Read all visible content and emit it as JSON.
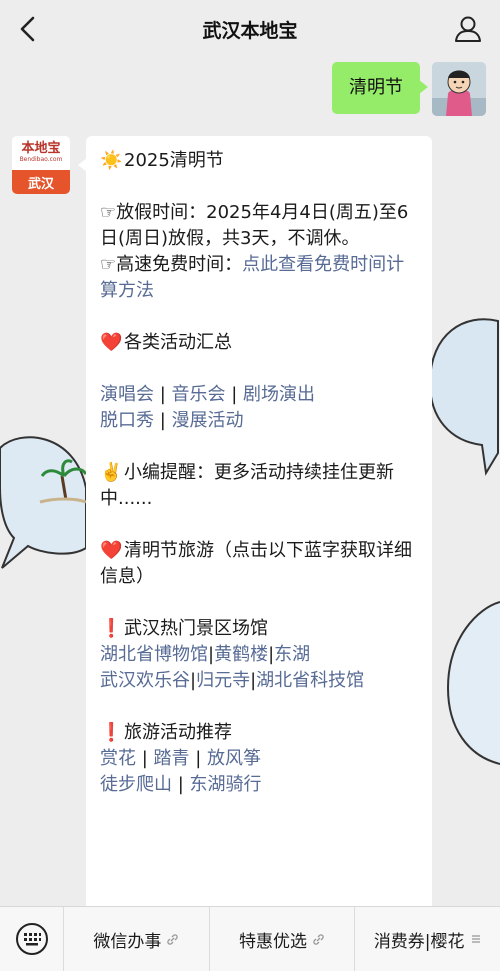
{
  "header": {
    "title": "武汉本地宝"
  },
  "my_message": {
    "text": "清明节"
  },
  "bot": {
    "avatar_brand": "本地宝",
    "avatar_brand_en": "Bendibao.com",
    "avatar_city": "武汉"
  },
  "message": {
    "heading": "2025清明节",
    "holiday_label": "☞放假时间：",
    "holiday_text": "2025年4月4日(周五)至6日(周日)放假，共3天，不调休。",
    "toll_label": "☞高速免费时间：",
    "toll_link": "点此查看免费时间计算方法",
    "events_heading": "各类活动汇总",
    "events_row1": [
      "演唱会",
      "音乐会",
      "剧场演出"
    ],
    "events_row2": [
      "脱口秀",
      "漫展活动"
    ],
    "reminder": "小编提醒：更多活动持续挂住更新中......",
    "travel_heading": "清明节旅游（点击以下蓝字获取详细信息）",
    "spots_heading": "武汉热门景区场馆",
    "spots_row1": [
      "湖北省博物馆",
      "黄鹤楼",
      "东湖"
    ],
    "spots_row2": [
      "武汉欢乐谷",
      "归元寺",
      "湖北省科技馆"
    ],
    "activities_heading": "旅游活动推荐",
    "activities_row1": [
      "赏花",
      "踏青",
      "放风筝"
    ],
    "activities_row2": [
      "徒步爬山",
      "东湖骑行"
    ]
  },
  "menu": {
    "items": [
      {
        "label": "微信办事"
      },
      {
        "label": "特惠优选"
      },
      {
        "label": "消费券|樱花"
      }
    ]
  },
  "icons": {
    "sun": "sun-icon",
    "heart": "heart-icon",
    "victory": "victory-hand-icon",
    "exclamation": "exclamation-icon"
  },
  "colors": {
    "link": "#576b95",
    "my_bubble": "#95ec69",
    "background": "#ededed"
  }
}
